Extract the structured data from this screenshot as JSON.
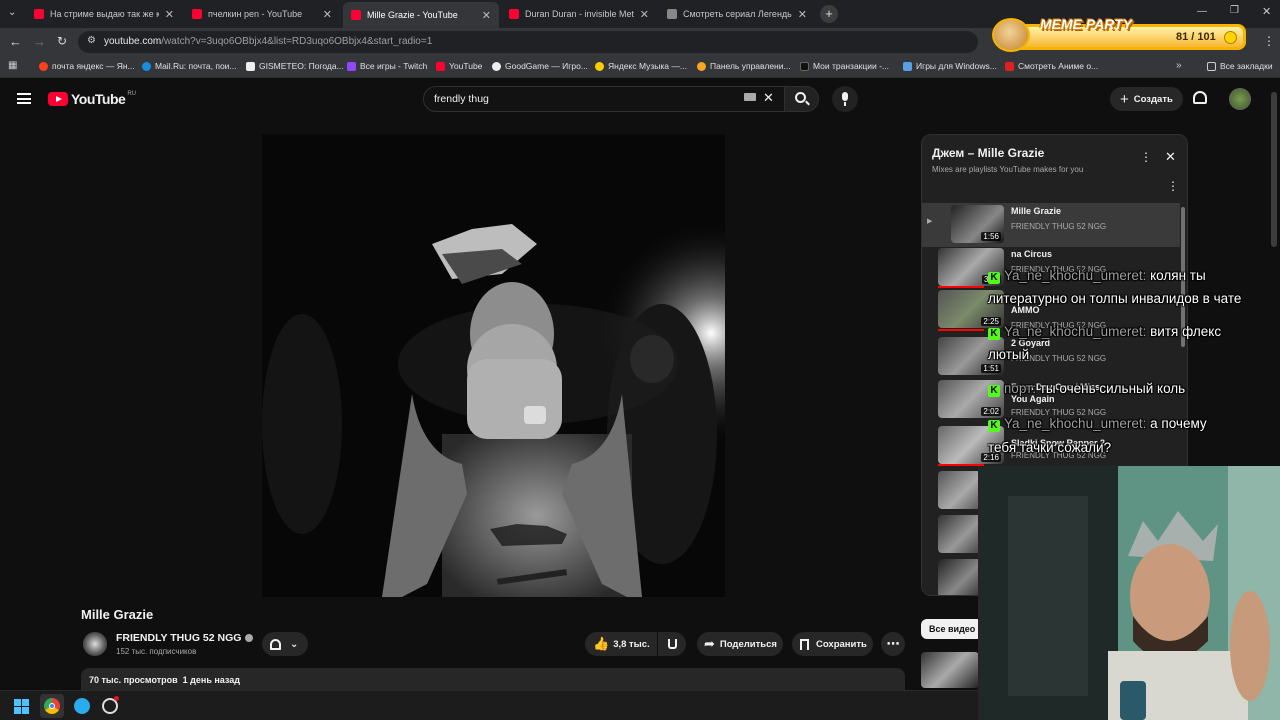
{
  "tabs": [
    {
      "label": "На стриме выдаю так же как Я",
      "favicon_color": "#ff0033"
    },
    {
      "label": "пчелкин pen - YouTube",
      "favicon_color": "#ff0033"
    },
    {
      "label": "Mille Grazie - YouTube",
      "favicon_color": "#ff0033"
    },
    {
      "label": "Duran Duran - invisible Metal G",
      "favicon_color": "#ff0033"
    },
    {
      "label": "Смотреть сериал Легенды о К",
      "favicon_color": "#888888"
    }
  ],
  "address": {
    "host": "youtube.com",
    "path": "/watch?v=3uqo6OBbjx4&list=RD3uqo6OBbjx4&start_radio=1"
  },
  "bookmarks": [
    {
      "label": "почта яндекс — Ян...",
      "color": "#fc3f1d"
    },
    {
      "label": "Mail.Ru: почта, пои...",
      "color": "#168de2"
    },
    {
      "label": "GISMETEO: Погода...",
      "color": "#ffffff"
    },
    {
      "label": "Все игры - Twitch",
      "color": "#9146ff"
    },
    {
      "label": "YouTube",
      "color": "#ff0033"
    },
    {
      "label": "GoodGame — Игро...",
      "color": "#ffffff"
    },
    {
      "label": "Яндекс Музыка —...",
      "color": "#ffcc00"
    },
    {
      "label": "Панель управлени...",
      "color": "#f5a623"
    },
    {
      "label": "Мои транзакции -...",
      "color": "#222222"
    },
    {
      "label": "Игры для Windows...",
      "color": "#5aa0e0"
    },
    {
      "label": "Смотреть Аниме о...",
      "color": "#e02020"
    }
  ],
  "bookmarks_all": "Все закладки",
  "meme": {
    "title": "MEME PARTY",
    "counter": "81 / 101"
  },
  "yt": {
    "logo_text": "YouTube",
    "region": "RU",
    "search_value": "frendly thug",
    "create_label": "Создать"
  },
  "video": {
    "title": "Mille Grazie",
    "channel": "FRIENDLY THUG 52 NGG",
    "subscribers": "152 тыс. подписчиков",
    "likes": "3,8 тыс.",
    "share_label": "Поделиться",
    "save_label": "Сохранить",
    "views_date": "70 тыс. просмотров  1 день назад"
  },
  "playlist": {
    "title": "Джем – Mille Grazie",
    "subtitle": "Mixes are playlists YouTube makes for you",
    "items": [
      {
        "title": "Mille Grazie",
        "channel": "FRIENDLY THUG 52 NGG",
        "duration": "1:56"
      },
      {
        "title": "na Circus",
        "channel": "FRIENDLY THUG 52 NGG",
        "duration": "3:11"
      },
      {
        "title": "AMMO",
        "channel": "FRIENDLY THUG 52 NGG",
        "duration": "2:25"
      },
      {
        "title": "2 Goyard",
        "channel": "FRIENDLY THUG 52 NGG",
        "duration": "1:51"
      },
      {
        "title": "From Day One / Miss You Again",
        "channel": "FRIENDLY THUG 52 NGG",
        "duration": "2:02"
      },
      {
        "title": "Sladki Snow Rapper 2",
        "channel": "FRIENDLY THUG 52 NGG",
        "duration": "2:16"
      }
    ]
  },
  "all_videos": "Все видео",
  "chat": [
    {
      "name": "Ya_ne_khochu_umeret:",
      "text": "колян ты"
    },
    {
      "name": "",
      "text": "литературно он толпы инвалидов в чате"
    },
    {
      "name": "Ya_ne_khochu_umeret:",
      "text": "витя флекс"
    },
    {
      "name": "",
      "text": "лютый"
    },
    {
      "name": "порт:",
      "text": "ты очень сильный коль"
    },
    {
      "name": "Ya_ne_khochu_umeret:",
      "text": "а почему"
    },
    {
      "name": "",
      "text": "тебя тачки сожали?"
    }
  ]
}
